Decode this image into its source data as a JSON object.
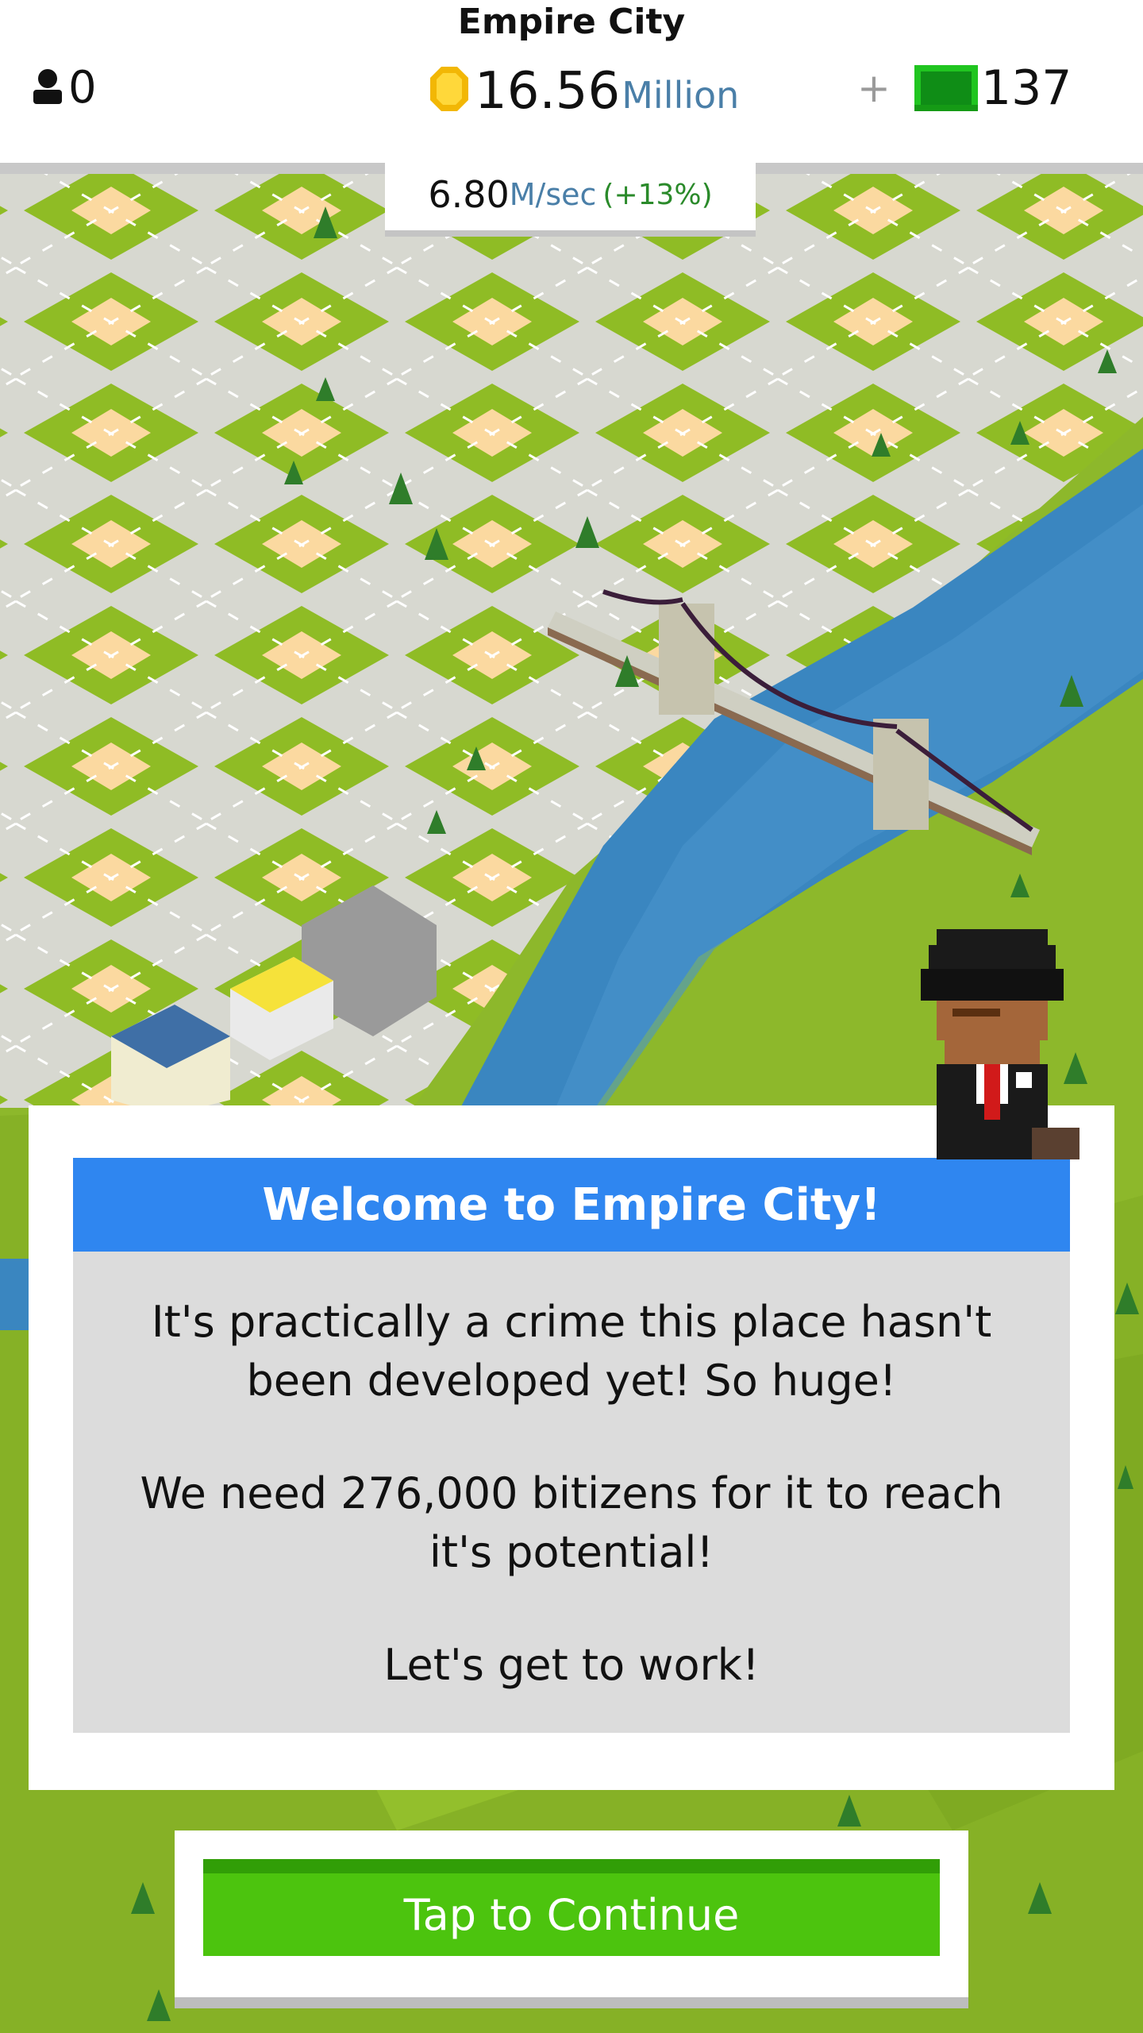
{
  "header": {
    "city_name": "Empire City",
    "population": "0",
    "coins_value": "16.56",
    "coins_unit": "Million",
    "bux_plus": "+",
    "bux_value": "137"
  },
  "income": {
    "rate_value": "6.80",
    "rate_unit": "M/sec",
    "rate_bonus": "(+13%)"
  },
  "dialog": {
    "title": "Welcome to Empire City!",
    "paragraphs": [
      "It's practically a crime this place hasn't been developed yet! So huge!",
      "We need 276,000 bitizens for it to reach it's potential!",
      "Let's get to work!"
    ]
  },
  "continue_button": {
    "label": "Tap to Continue"
  },
  "colors": {
    "header_blue": "#2f86f0",
    "button_green": "#4cc40e",
    "grass": "#8db82b",
    "water": "#3a86c0",
    "lot": "#fbd9a0",
    "road": "#d7d8d0"
  },
  "icons": [
    "person-icon",
    "coin-icon",
    "bux-icon",
    "agent-character",
    "bridge-icon",
    "tree-icon"
  ]
}
